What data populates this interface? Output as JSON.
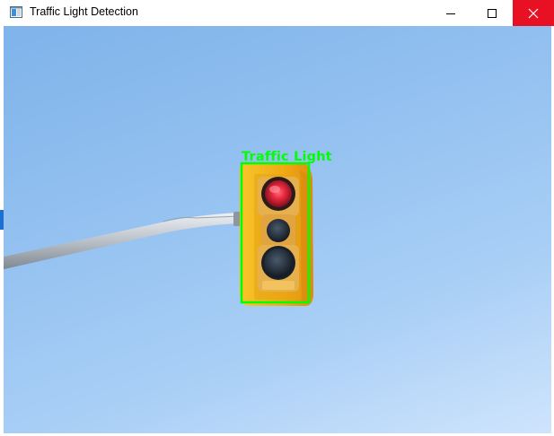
{
  "window": {
    "title": "Traffic Light Detection",
    "app_icon": "window-app-icon",
    "controls": {
      "minimize_icon": "minimize-icon",
      "maximize_icon": "maximize-icon",
      "close_icon": "close-icon"
    }
  },
  "image": {
    "subject": "traffic signal on pole against blue sky",
    "active_light": "red"
  },
  "detection": {
    "label": "Traffic Light",
    "box_color": "#00ff00"
  },
  "colors": {
    "close_button": "#e81123",
    "signal_housing": "#f2b21a",
    "red_lamp": "#e8283c",
    "sky": "#92c0f0"
  }
}
